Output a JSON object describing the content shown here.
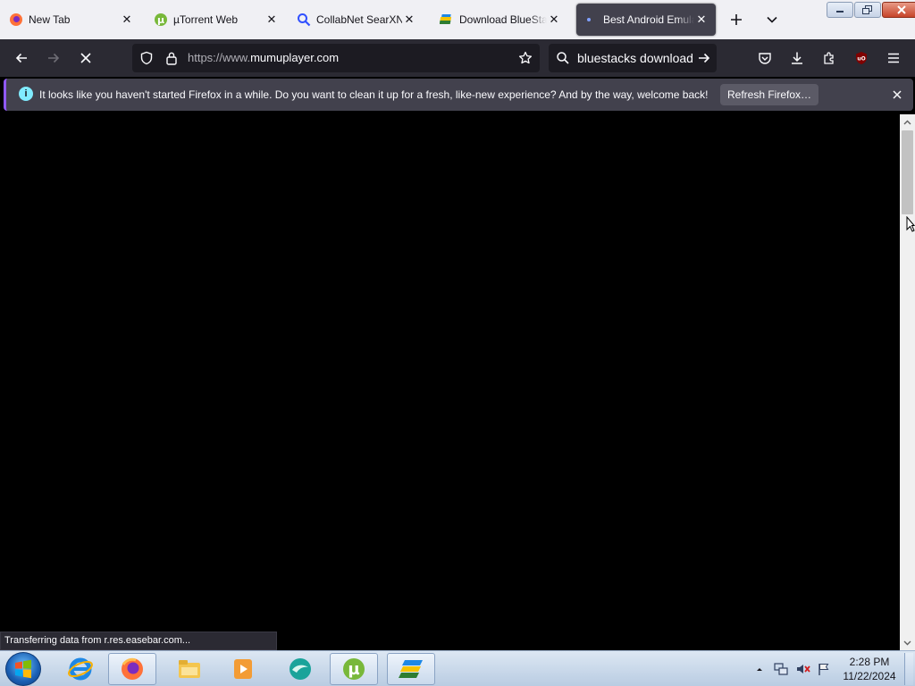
{
  "tabs": [
    {
      "title": "New Tab",
      "icon": "firefox-icon"
    },
    {
      "title": "µTorrent Web",
      "icon": "utorrent-icon"
    },
    {
      "title": "CollabNet SearXNG",
      "icon": "search-icon"
    },
    {
      "title": "Download BlueStacks",
      "icon": "bluestacks-icon"
    },
    {
      "title": "Best Android Emulator",
      "icon": "loading-dot-icon"
    }
  ],
  "active_tab_index": 4,
  "nav": {
    "url_prefix": "https://www.",
    "url_host": "mumuplayer.com",
    "search_text": "bluestacks download"
  },
  "notification": {
    "message": "It looks like you haven't started Firefox in a while. Do you want to clean it up for a fresh, like-new experience? And by the way, welcome back!",
    "button_label": "Refresh Firefox…"
  },
  "status_text": "Transferring data from r.res.easebar.com...",
  "taskbar": {
    "apps": [
      "internet-explorer-icon",
      "firefox-icon",
      "file-explorer-icon",
      "media-player-icon",
      "app-icon",
      "utorrent-icon",
      "bluestacks-icon"
    ],
    "time": "2:28 PM",
    "date": "11/22/2024"
  },
  "colors": {
    "accent": "#9059ff",
    "toolbar": "#2b2a33",
    "info": "#80ebff"
  }
}
